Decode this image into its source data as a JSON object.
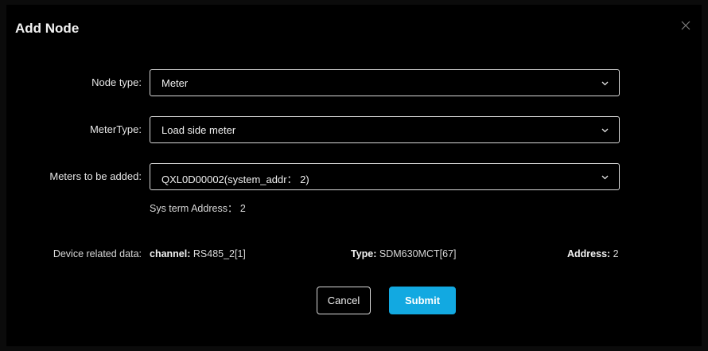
{
  "dialog": {
    "title": "Add Node",
    "close_icon": "close-icon"
  },
  "form": {
    "node_type": {
      "label": "Node type:",
      "value": "Meter"
    },
    "meter_type": {
      "label": "MeterType:",
      "value": "Load side meter"
    },
    "meters_to_add": {
      "label": "Meters to be added:",
      "value": "QXL0D00002(system_addr： 2)"
    },
    "sys_term_address": "Sys term Address： 2"
  },
  "device_data": {
    "label": "Device related data:",
    "channel_key": "channel:",
    "channel_value": " RS485_2[1]",
    "type_key": "Type:",
    "type_value": " SDM630MCT[67]",
    "address_key": "Address:",
    "address_value": " 2"
  },
  "buttons": {
    "cancel": "Cancel",
    "submit": "Submit"
  },
  "colors": {
    "accent": "#12a9e1",
    "background": "#000000",
    "border": "#d9d9d9"
  }
}
